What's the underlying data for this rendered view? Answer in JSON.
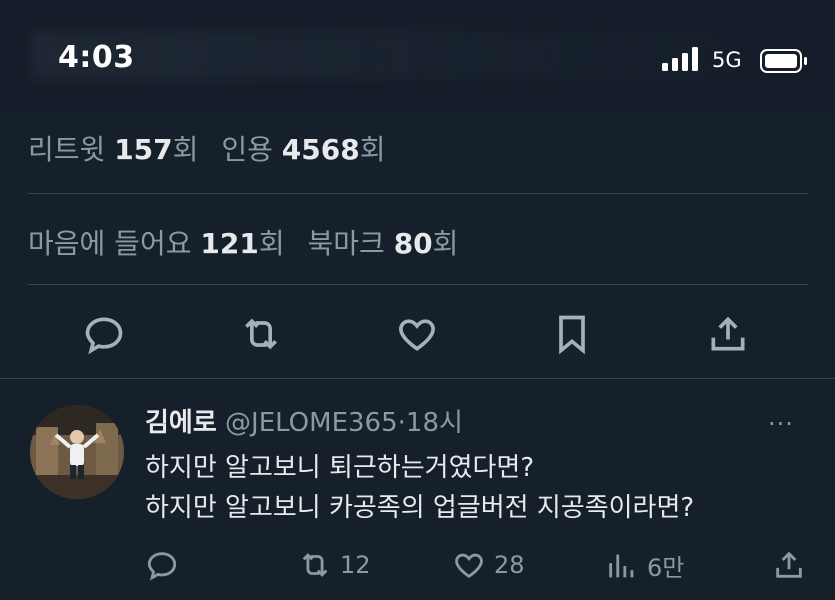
{
  "status_bar": {
    "time": "4:03",
    "network": "5G"
  },
  "stats": {
    "retweets_label": "리트윗",
    "retweets_value": "157",
    "retweets_suffix": "회",
    "quotes_label": "인용",
    "quotes_value": "4568",
    "quotes_suffix": "회",
    "likes_label": "마음에 들어요",
    "likes_value": "121",
    "likes_suffix": "회",
    "bookmarks_label": "북마크",
    "bookmarks_value": "80",
    "bookmarks_suffix": "회"
  },
  "action_bar": [
    "reply-icon",
    "retweet-icon",
    "like-icon",
    "bookmark-icon",
    "share-icon"
  ],
  "reply": {
    "name": "김에로",
    "handle": "@JELOME365",
    "time": "·18시",
    "more": "···",
    "text_line1": "하지만 알고보니 퇴근하는거였다면?",
    "text_line2": "하지만 알고보니 카공족의 업글버전 지공족이라면?",
    "retweet_count": "12",
    "like_count": "28",
    "views_count": "6만"
  },
  "colors": {
    "background": "#15202b",
    "text": "#e7e9ea",
    "muted": "#8b98a5",
    "divider": "#38444d"
  }
}
